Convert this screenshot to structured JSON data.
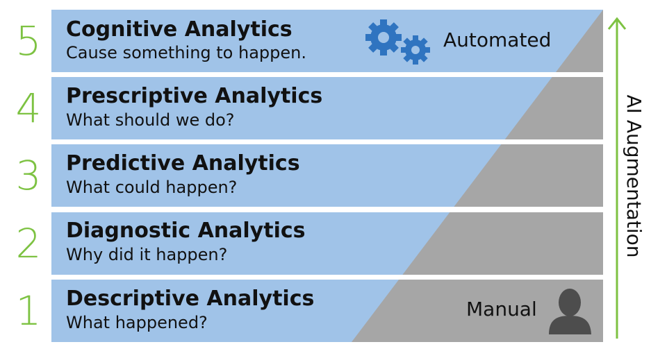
{
  "diagram": {
    "levels": [
      {
        "number": "5",
        "title": "Cognitive Analytics",
        "subtitle": "Cause something to happen."
      },
      {
        "number": "4",
        "title": "Prescriptive Analytics",
        "subtitle": "What should we do?"
      },
      {
        "number": "3",
        "title": "Predictive Analytics",
        "subtitle": "What could happen?"
      },
      {
        "number": "2",
        "title": "Diagnostic Analytics",
        "subtitle": "Why did it happen?"
      },
      {
        "number": "1",
        "title": "Descriptive Analytics",
        "subtitle": "What happened?"
      }
    ],
    "top_label": "Automated",
    "bottom_label": "Manual",
    "axis_label": "AI Augmentation",
    "icons": {
      "top": "gears-icon",
      "bottom": "person-icon",
      "axis": "arrow-up-icon"
    },
    "colors": {
      "band_blue": "#a0c3e8",
      "band_gray": "#a6a6a6",
      "accent_green": "#7dc242",
      "gear_blue": "#2f74c0",
      "person_gray": "#4d4d4d",
      "text": "#111111"
    }
  }
}
